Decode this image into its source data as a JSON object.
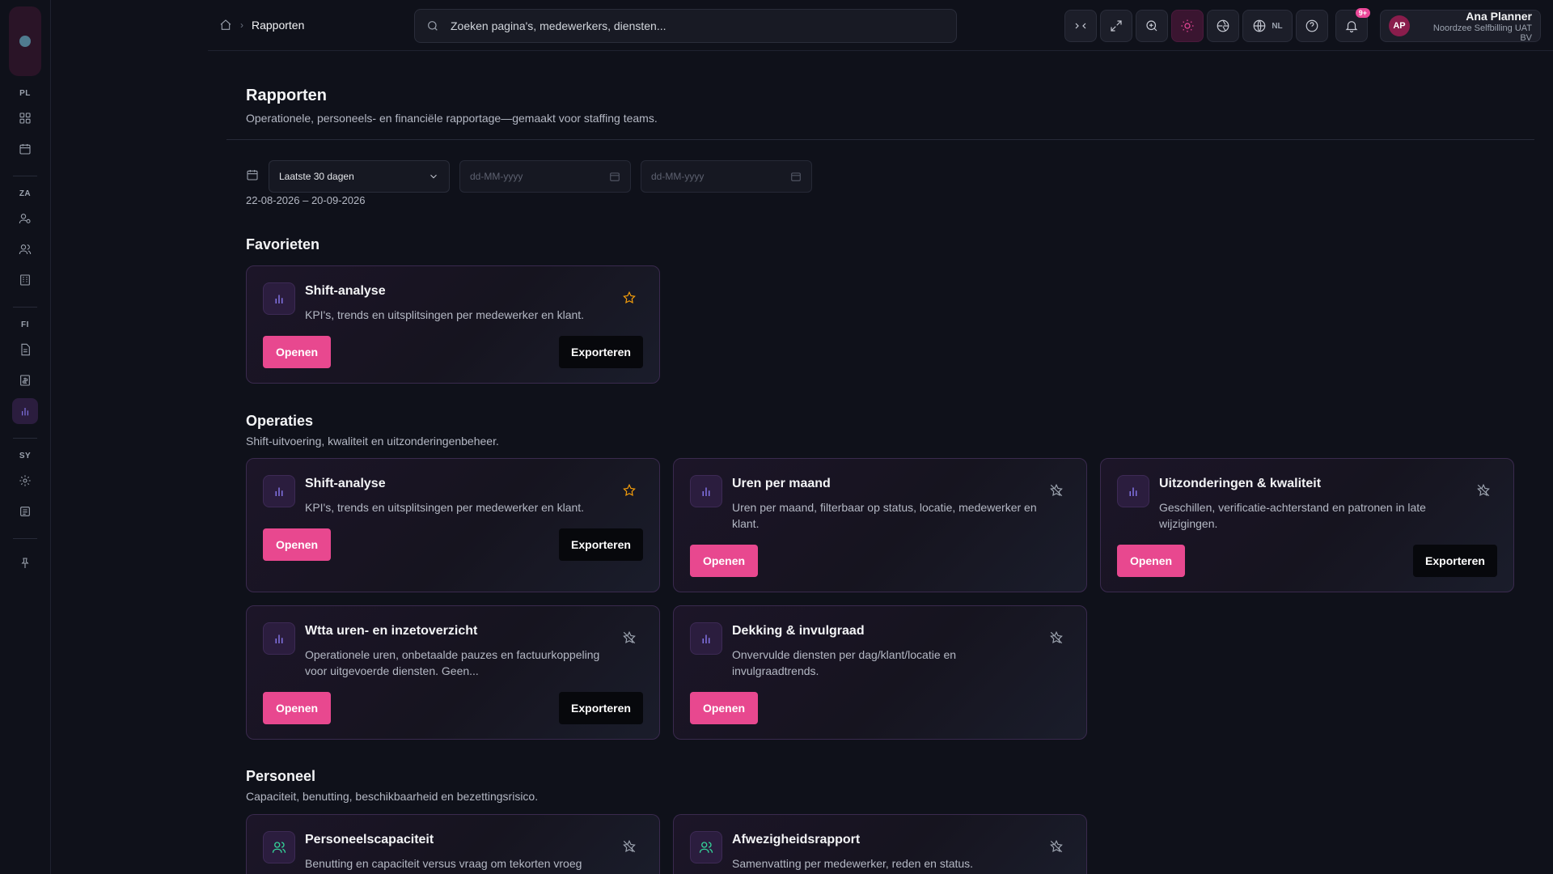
{
  "topbar": {
    "breadcrumb_current": "Rapporten",
    "search_placeholder": "Zoeken pagina's, medewerkers, diensten...",
    "lang": "NL",
    "notif_badge": "9+",
    "user": {
      "initials": "AP",
      "name": "Ana Planner",
      "org": "Noordzee Selfbilling UAT BV"
    }
  },
  "sidebar": {
    "sections": [
      "PL",
      "ZA",
      "FI",
      "SY"
    ]
  },
  "page": {
    "title": "Rapporten",
    "subtitle": "Operationele, personeels- en financiële rapportage—gemaakt voor staffing teams."
  },
  "filters": {
    "period": "Laatste 30 dagen",
    "date_from_placeholder": "dd-MM-yyyy",
    "date_to_placeholder": "dd-MM-yyyy",
    "range_text": "22-08-2026 – 20-09-2026"
  },
  "sections": {
    "favorites": {
      "title": "Favorieten"
    },
    "operations": {
      "title": "Operaties",
      "subtitle": "Shift-uitvoering, kwaliteit en uitzonderingenbeheer."
    },
    "personnel": {
      "title": "Personeel",
      "subtitle": "Capaciteit, benutting, beschikbaarheid en bezettingsrisico."
    }
  },
  "buttons": {
    "open": "Openen",
    "export": "Exporteren"
  },
  "cards": {
    "fav_shift": {
      "title": "Shift-analyse",
      "desc": "KPI's, trends en uitsplitsingen per medewerker en klant.",
      "favorite": true
    },
    "ops_shift": {
      "title": "Shift-analyse",
      "desc": "KPI's, trends en uitsplitsingen per medewerker en klant.",
      "favorite": true
    },
    "ops_hours": {
      "title": "Uren per maand",
      "desc": "Uren per maand, filterbaar op status, locatie, medewerker en klant.",
      "favorite": false
    },
    "ops_exceptions": {
      "title": "Uitzonderingen & kwaliteit",
      "desc": "Geschillen, verificatie-achterstand en patronen in late wijzigingen.",
      "favorite": false
    },
    "ops_wtta": {
      "title": "Wtta uren- en inzetoverzicht",
      "desc": "Operationele uren, onbetaalde pauzes en factuurkoppeling voor uitgevoerde diensten. Geen...",
      "favorite": false
    },
    "ops_coverage": {
      "title": "Dekking & invulgraad",
      "desc": "Onvervulde diensten per dag/klant/locatie en invulgraadtrends.",
      "favorite": false
    },
    "per_capacity": {
      "title": "Personeelscapaciteit",
      "desc": "Benutting en capaciteit versus vraag om tekorten vroeg",
      "favorite": false
    },
    "per_absence": {
      "title": "Afwezigheidsrapport",
      "desc": "Samenvatting per medewerker, reden en status.",
      "favorite": false
    }
  },
  "colors": {
    "accent": "#e8488f",
    "favorite_star": "#f59e0b",
    "icon_purple": "#8b7cf6",
    "icon_teal": "#34d399"
  }
}
